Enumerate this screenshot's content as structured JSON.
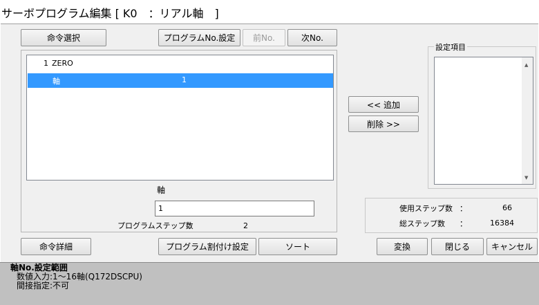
{
  "window": {
    "title": "サーボプログラム編集 [ K0　：リアル軸　]"
  },
  "toolbar": {
    "command_select": "命令選択",
    "program_no_setting": "プログラムNo.設定",
    "prev_no": "前No.",
    "next_no": "次No."
  },
  "program_list": {
    "rows": [
      {
        "num": "1",
        "label": "ZERO",
        "value": ""
      },
      {
        "num": "",
        "label": "軸",
        "value": "1"
      }
    ]
  },
  "editor": {
    "field_label": "軸",
    "field_value": "1",
    "step_label": "プログラムステップ数",
    "colon": "：",
    "step_value": "2"
  },
  "move_buttons": {
    "add": "<< 追加",
    "remove": "削除 >>"
  },
  "settings": {
    "title": "設定項目"
  },
  "steps_info": {
    "used_label": "使用ステップ数",
    "used_value": "66",
    "total_label": "総ステップ数",
    "total_value": "16384",
    "colon": "："
  },
  "bottom_buttons": {
    "command_detail": "命令詳細",
    "program_allocation": "プログラム割付け設定",
    "sort": "ソート",
    "convert": "変換",
    "close": "閉じる",
    "cancel": "キャンセル"
  },
  "status": {
    "line1": "軸No.設定範囲",
    "line2": "数値入力:1～16軸(Q172DSCPU)",
    "line3": "間接指定:不可"
  },
  "colors": {
    "selection": "#3399ff",
    "window_bg": "#f0f0f0",
    "status_bg": "#c0c0c0"
  }
}
